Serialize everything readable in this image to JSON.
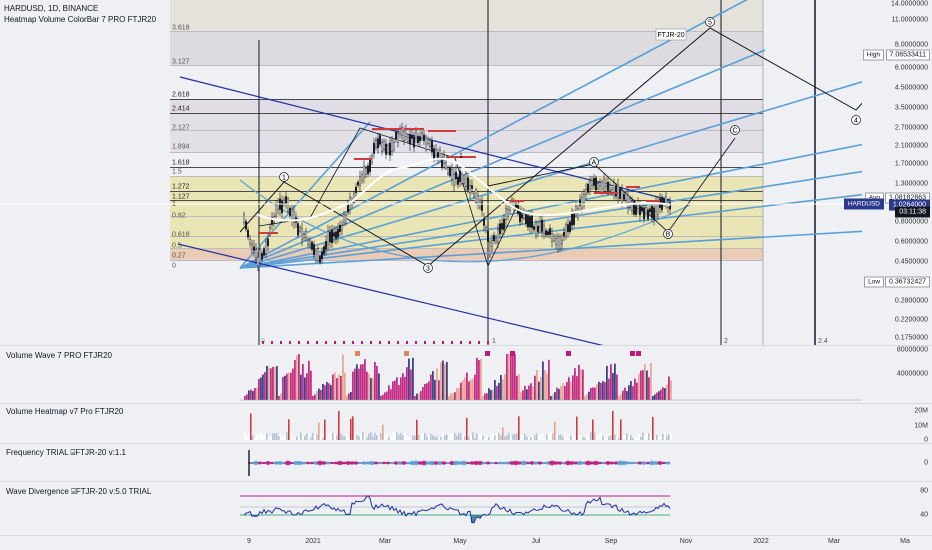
{
  "header": {
    "symbol_line": "HARDUSD, 1D, BINANCE",
    "indicator_line": "Heatmap Volume ColorBar  7 PRO  FTJR20"
  },
  "main_pane": {
    "price_ticks": [
      "14.0000000",
      "11.0000000",
      "8.0000000",
      "6.0000000",
      "4.5000000",
      "3.5000000",
      "2.7000000",
      "2.1000000",
      "1.7000000",
      "1.3000000",
      "1.0000000",
      "0.8000000",
      "0.6000000",
      "0.4500000",
      "0.3800000",
      "0.2800000",
      "0.2200000",
      "0.1750000"
    ],
    "fib_levels": [
      "3.618",
      "3.127",
      "2.618",
      "2.414",
      "2.127",
      "1.894",
      "1.618",
      "1.5",
      "1.272",
      "1.127",
      "1",
      "0.82",
      "0.618",
      "0.5",
      "0.27",
      "0"
    ],
    "tags": {
      "high_label": "High",
      "high_value": "7.06533411",
      "avg_label": "Avg",
      "avg_value": "1.08182863",
      "symbol_tag": "HARDUSD",
      "last_price": "1.0264000",
      "countdown": "03:11:38",
      "low_label": "Low",
      "low_value": "0.36732427"
    },
    "annotation_box": "FTJR-20",
    "wave_labels": [
      "1",
      "2",
      "3",
      "4",
      "5",
      "A",
      "B",
      "C",
      "1",
      "2",
      "2.4"
    ],
    "bottom_marks": [
      "0",
      "1",
      "2",
      "2.4"
    ]
  },
  "panes": [
    {
      "label": "Volume Wave  7 PRO  FTJR20",
      "ticks": [
        "80000000",
        "40000000",
        "0"
      ]
    },
    {
      "label": "Volume Heatmap   v7 Pro  FTJR20",
      "ticks": [
        "20M",
        "10M",
        "0"
      ]
    },
    {
      "label": "Frequency TRIAL  ⌸FTJR-20 v:1.1",
      "ticks": [
        "0"
      ]
    },
    {
      "label": "Wave Divergence  ⌸FTJR-20 v:5.0 TRIAL",
      "ticks": [
        "80",
        "40"
      ]
    }
  ],
  "x_axis": [
    "9",
    "2021",
    "Mar",
    "May",
    "Jul",
    "Sep",
    "Nov",
    "2022",
    "Mar",
    "Ma"
  ],
  "colors": {
    "trend_blue": "#1d2fa8",
    "fan_blue": "#5aa0d8",
    "bar_pink": "#c2187a",
    "bar_navy": "#2a2f7a",
    "candle": "#131722",
    "yellow_zone": "#e8e2a0"
  }
}
